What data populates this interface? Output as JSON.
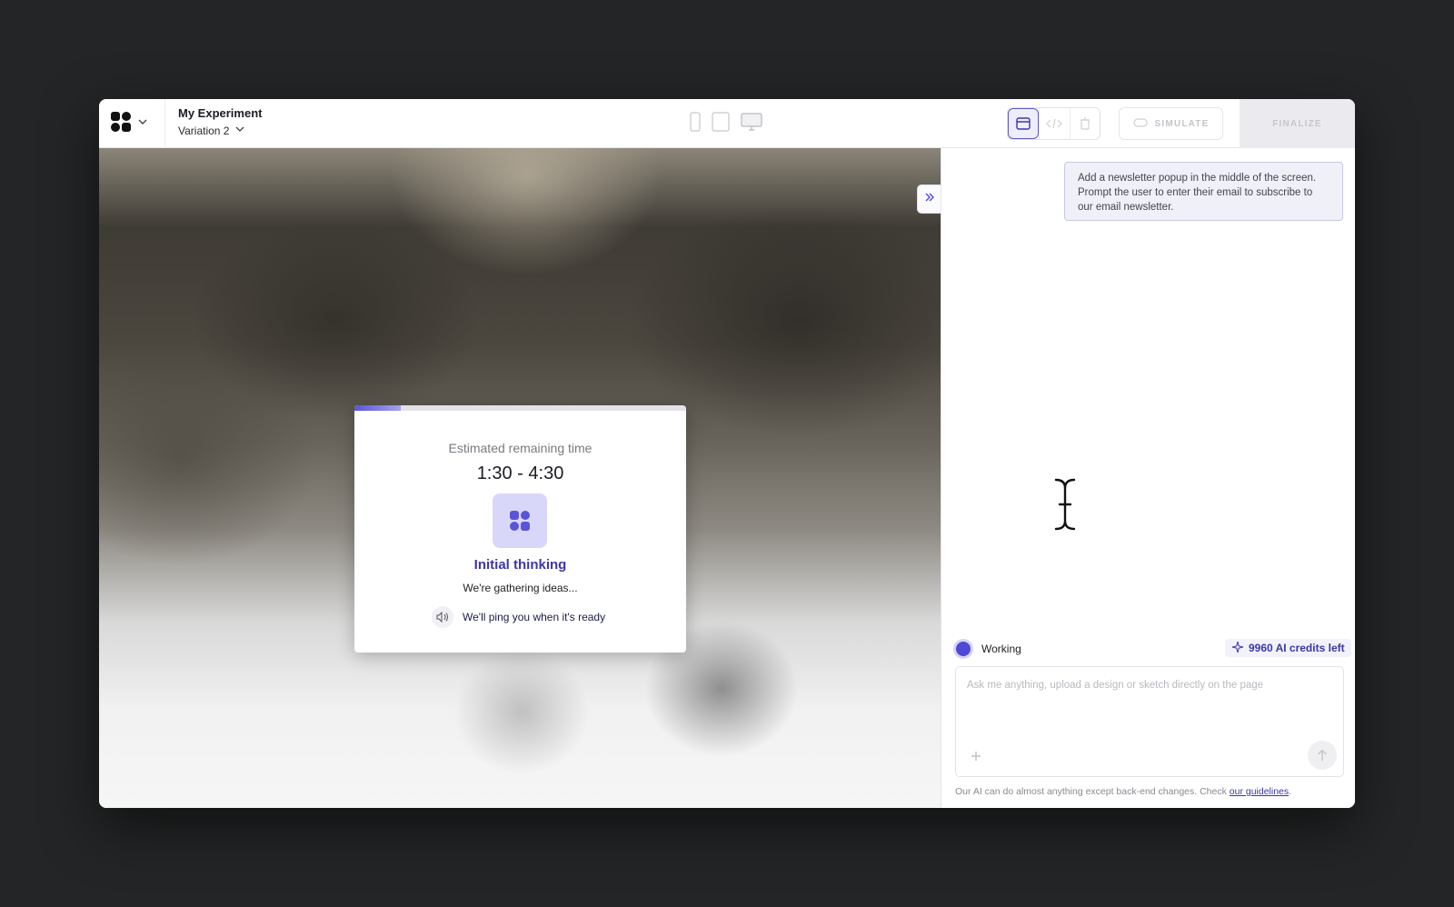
{
  "header": {
    "title": "My Experiment",
    "variation": "Variation 2",
    "simulate_label": "SIMULATE",
    "finalize_label": "FINALIZE",
    "device_icons": [
      "mobile-icon",
      "tablet-icon",
      "desktop-icon"
    ],
    "view_icons": [
      "browser-view-icon",
      "code-view-icon",
      "trash-icon"
    ],
    "active_view": "browser-view-icon"
  },
  "progress_card": {
    "estimate_label": "Estimated remaining time",
    "estimate_time": "1:30 - 4:30",
    "phase_title": "Initial thinking",
    "phase_subtitle": "We're gathering ideas...",
    "ping_text": "We'll ping you when it's ready",
    "progress_fraction": 0.14
  },
  "sidebar": {
    "user_message": "Add a newsletter popup in the middle of the screen. Prompt the user to enter their email to subscribe to our email newsletter.",
    "status": "Working",
    "credits": "9960 AI credits left",
    "input_placeholder": "Ask me anything, upload a design or sketch directly on the page",
    "disclaimer": "Our AI can do almost anything except back-end changes. Check ",
    "guidelines_link": "our guidelines",
    "disclaimer_end": "."
  },
  "colors": {
    "accent": "#4f49d6",
    "accent_dark": "#3d36a8",
    "accent_light": "#d8d7f9",
    "backdrop": "#232526"
  }
}
